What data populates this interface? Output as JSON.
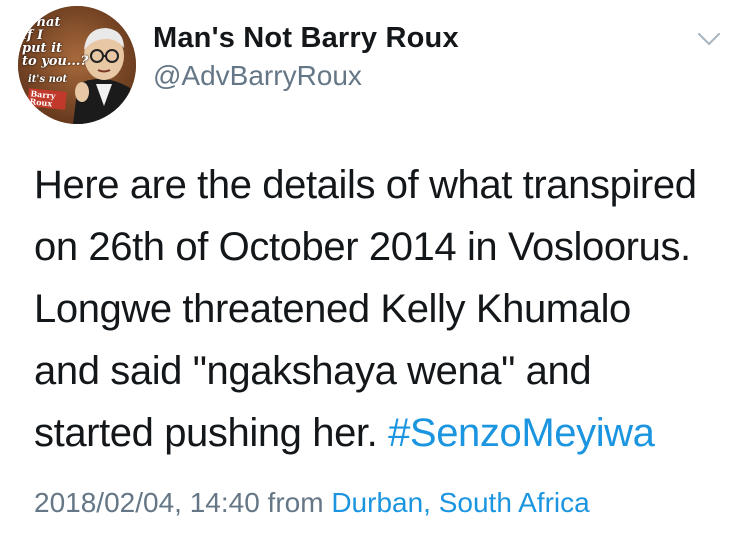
{
  "author": {
    "display_name": "Man's Not Barry Roux",
    "handle": "@AdvBarryRoux",
    "avatar_caption": "What\nif I\nput it\nto you...?",
    "avatar_caption2": "it's not",
    "avatar_sign": "Barry\nRoux"
  },
  "header": {
    "menu_icon": "chevron-down-icon"
  },
  "tweet": {
    "lines": [
      "Here are the details of what transpired",
      "on 26th of October 2014 in Vosloorus.",
      "Longwe threatened Kelly Khumalo",
      "and said \"ngakshaya wena\" and"
    ],
    "last_line_text": "started pushing her. ",
    "hashtag": "#SenzoMeyiwa"
  },
  "footer": {
    "timestamp": "2018/02/04, 14:40",
    "from_label": "from",
    "location": "Durban, South Africa"
  },
  "colors": {
    "link": "#1b95e0",
    "secondary_text": "#657786",
    "primary_text": "#14171a"
  }
}
